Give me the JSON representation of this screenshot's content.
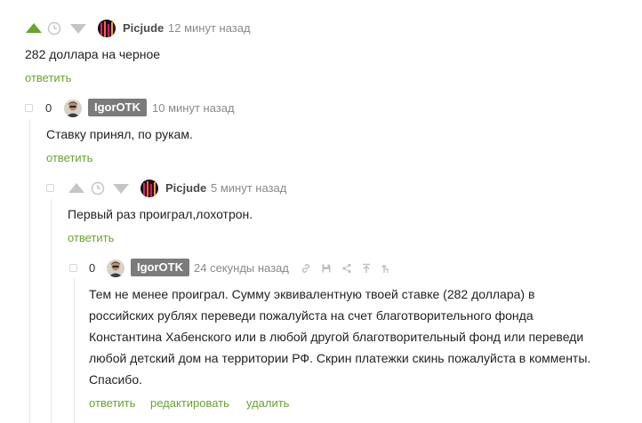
{
  "comments": [
    {
      "author": "Picjude",
      "time": "12 минут назад",
      "text": "282 доллара на черное",
      "actions": [
        "ответить"
      ]
    },
    {
      "rating": "0",
      "author": "IgorOTK",
      "time": "10 минут назад",
      "text": "Ставку принял, по рукам.",
      "actions": [
        "ответить"
      ]
    },
    {
      "author": "Picjude",
      "time": "5 минут назад",
      "text": "Первый раз проиграл,лохотрон.",
      "actions": [
        "ответить"
      ]
    },
    {
      "rating": "0",
      "author": "IgorOTK",
      "time": "24 секунды назад",
      "text_lines": [
        "Тем не менее проиграл. Сумму эквивалентную твоей ставке (282 доллара) в",
        "российских рублях переведи пожалуйста на счет благотворительного фонда",
        "Константина Хабенского или в любой другой благотворительный фонд или переведи",
        "любой детский дом на территории РФ. Скрин платежки скинь пожалуйста в комменты.",
        "Спасибо."
      ],
      "actions": [
        "ответить",
        "редактировать",
        "удалить"
      ],
      "tool_icons": [
        "link-icon",
        "save-icon",
        "share-icon",
        "go-to-parent-icon",
        "go-to-root-icon"
      ]
    }
  ],
  "colors": {
    "upvote_active": "#6ba232",
    "link": "#6ba232",
    "badge": "#7b7b7b",
    "thread_line": "#e6e6e6",
    "muted": "#8a8a8a"
  }
}
